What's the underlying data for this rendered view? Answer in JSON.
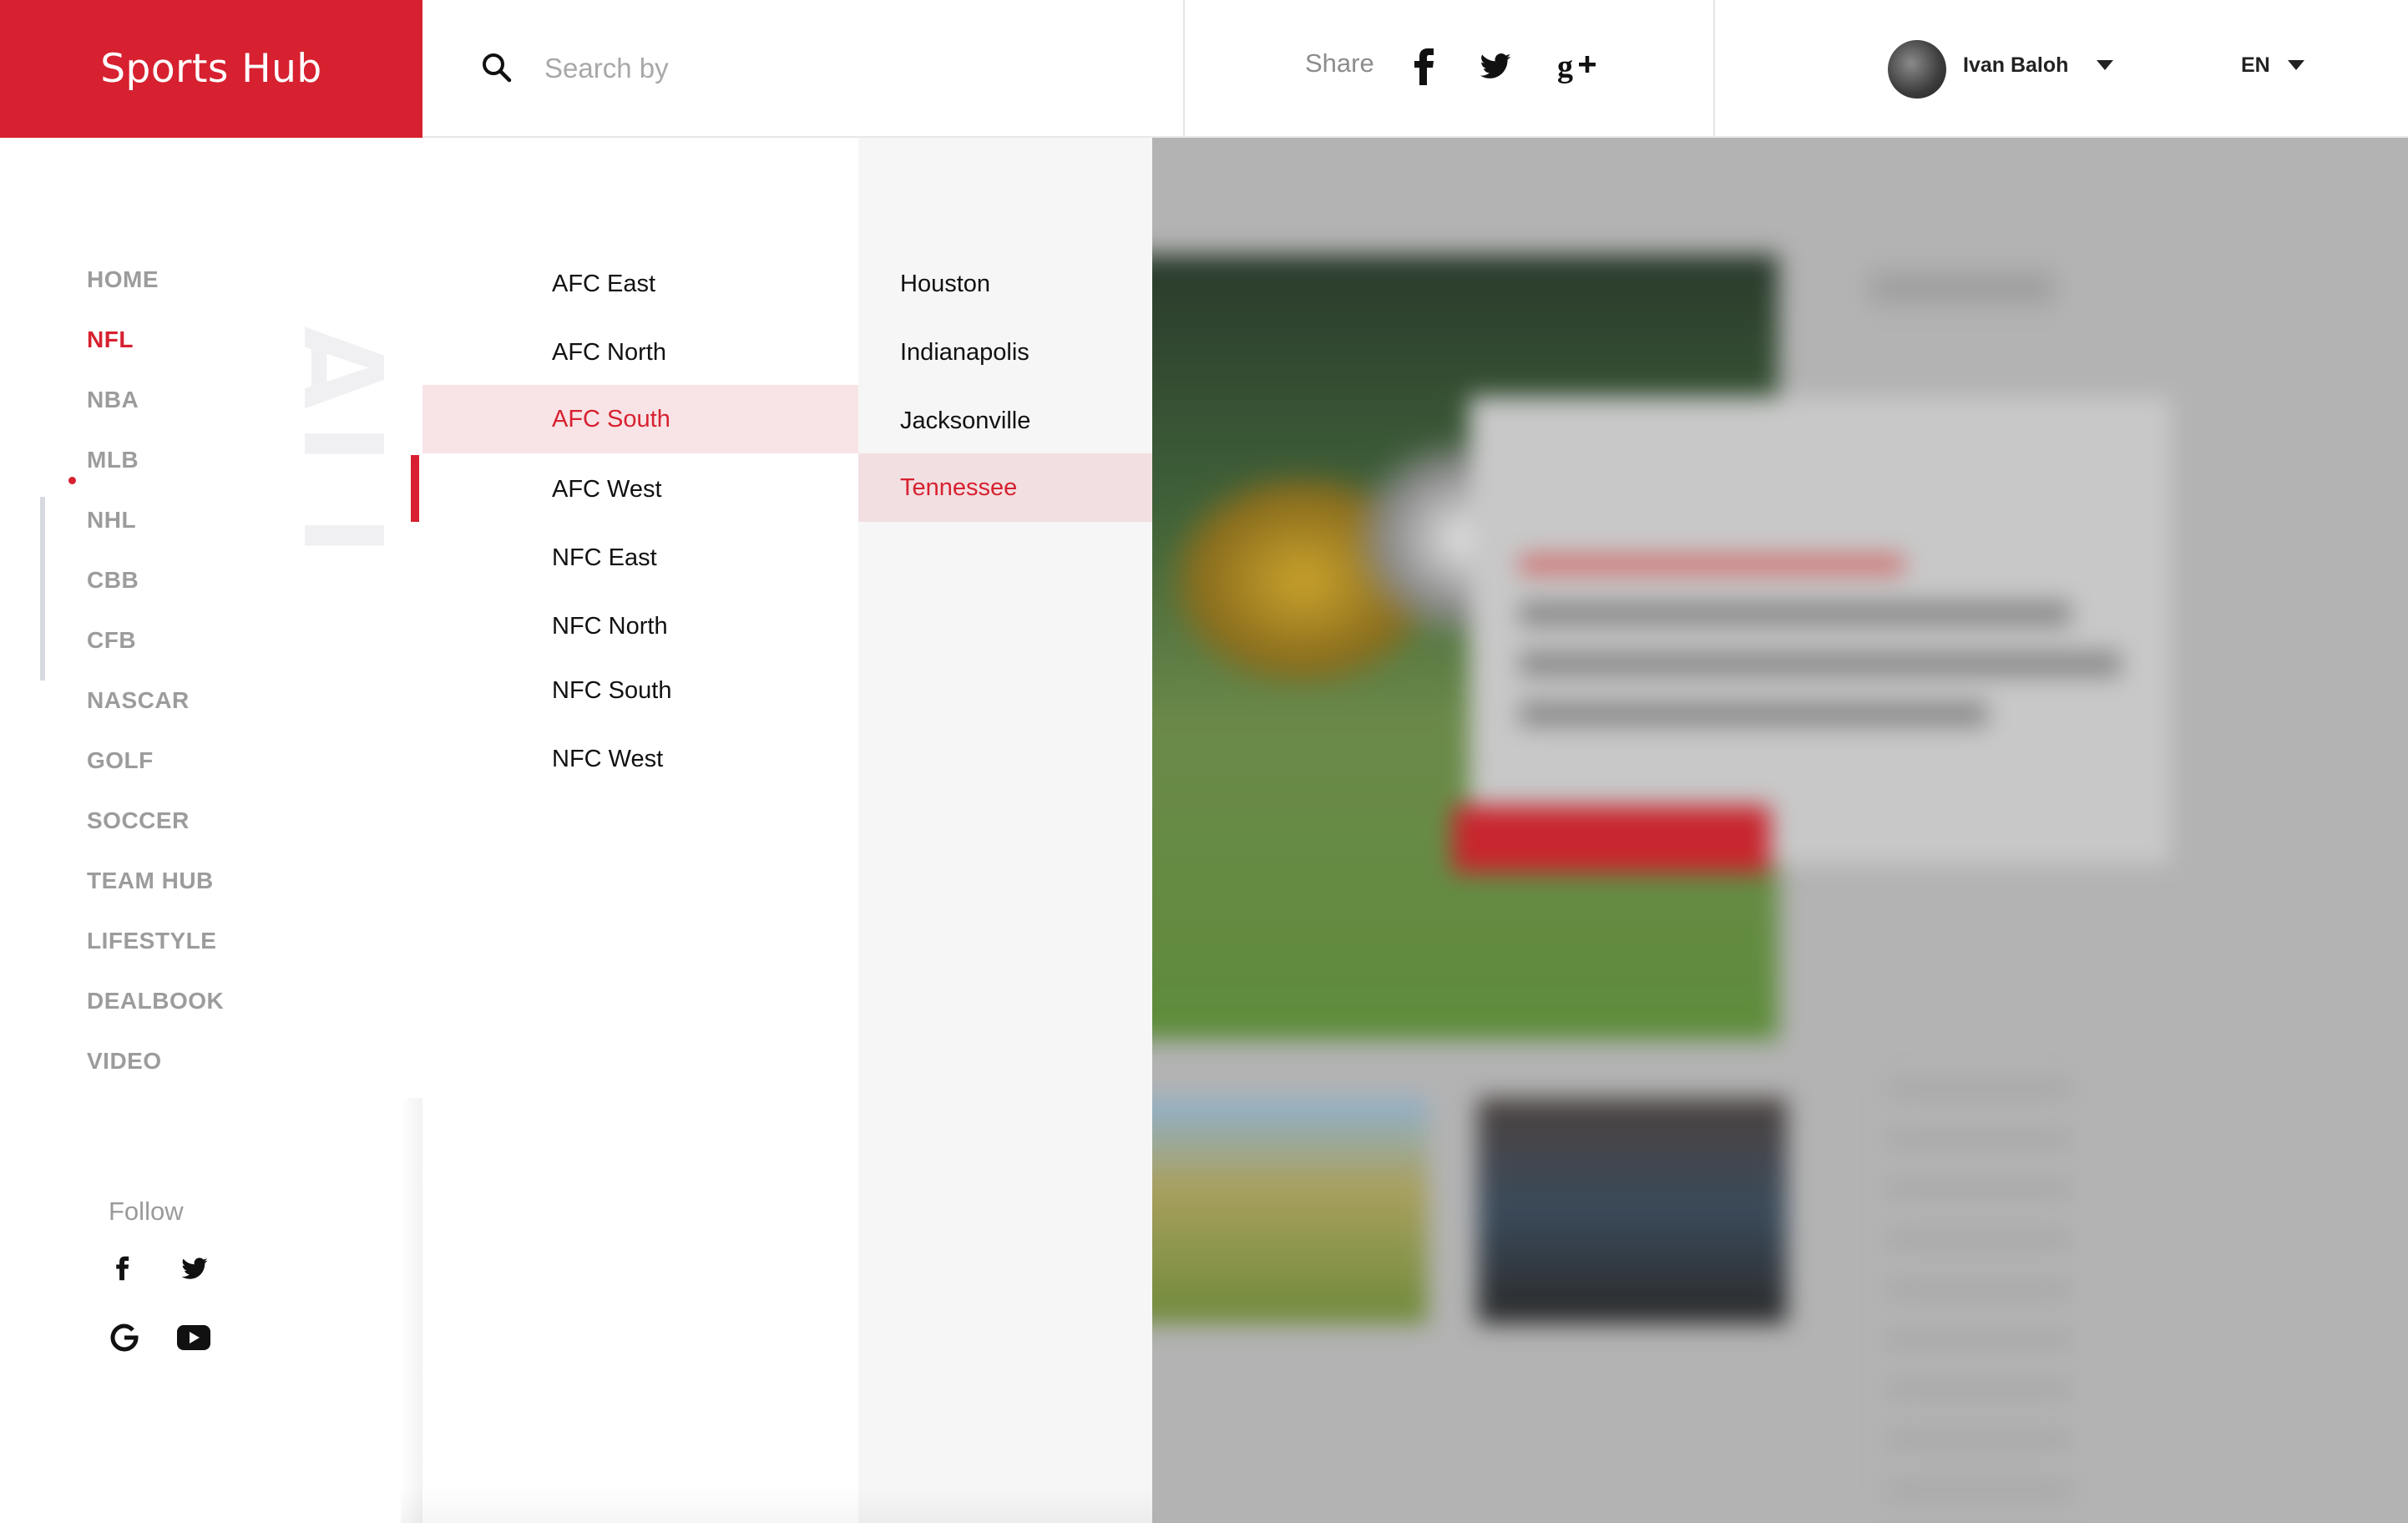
{
  "brand": {
    "name": "Sports Hub",
    "color": "#d72130"
  },
  "search": {
    "placeholder": "Search by",
    "icon": "search-icon"
  },
  "share": {
    "label": "Share",
    "icons": [
      "facebook-icon",
      "twitter-icon",
      "google-plus-icon"
    ]
  },
  "user": {
    "name": "Ivan Baloh",
    "avatar": "avatar"
  },
  "language": {
    "current": "EN"
  },
  "sidebar": {
    "watermark": "ALL",
    "items": [
      {
        "label": "HOME",
        "active": false
      },
      {
        "label": "NFL",
        "active": true
      },
      {
        "label": "NBA",
        "active": false
      },
      {
        "label": "MLB",
        "active": false
      },
      {
        "label": "NHL",
        "active": false
      },
      {
        "label": "CBB",
        "active": false
      },
      {
        "label": "CFB",
        "active": false
      },
      {
        "label": "NASCAR",
        "active": false
      },
      {
        "label": "GOLF",
        "active": false
      },
      {
        "label": "SOCCER",
        "active": false
      },
      {
        "label": "TEAM HUB",
        "active": false
      },
      {
        "label": "LIFESTYLE",
        "active": false
      },
      {
        "label": "DEALBOOK",
        "active": false
      },
      {
        "label": "VIDEO",
        "active": false
      }
    ],
    "follow": {
      "label": "Follow",
      "icons": [
        "facebook-icon",
        "twitter-icon",
        "google-icon",
        "youtube-icon"
      ]
    }
  },
  "divisions": {
    "items": [
      {
        "label": "AFC East",
        "active": false
      },
      {
        "label": "AFC North",
        "active": false
      },
      {
        "label": "AFC South",
        "active": true
      },
      {
        "label": "AFC West",
        "active": false
      },
      {
        "label": "NFC East",
        "active": false
      },
      {
        "label": "NFC North",
        "active": false
      },
      {
        "label": "NFC South",
        "active": false
      },
      {
        "label": "NFC West",
        "active": false
      }
    ]
  },
  "teams": {
    "items": [
      {
        "label": "Houston",
        "active": false
      },
      {
        "label": "Indianapolis",
        "active": false
      },
      {
        "label": "Jacksonville",
        "active": false
      },
      {
        "label": "Tennessee",
        "active": true
      }
    ]
  }
}
